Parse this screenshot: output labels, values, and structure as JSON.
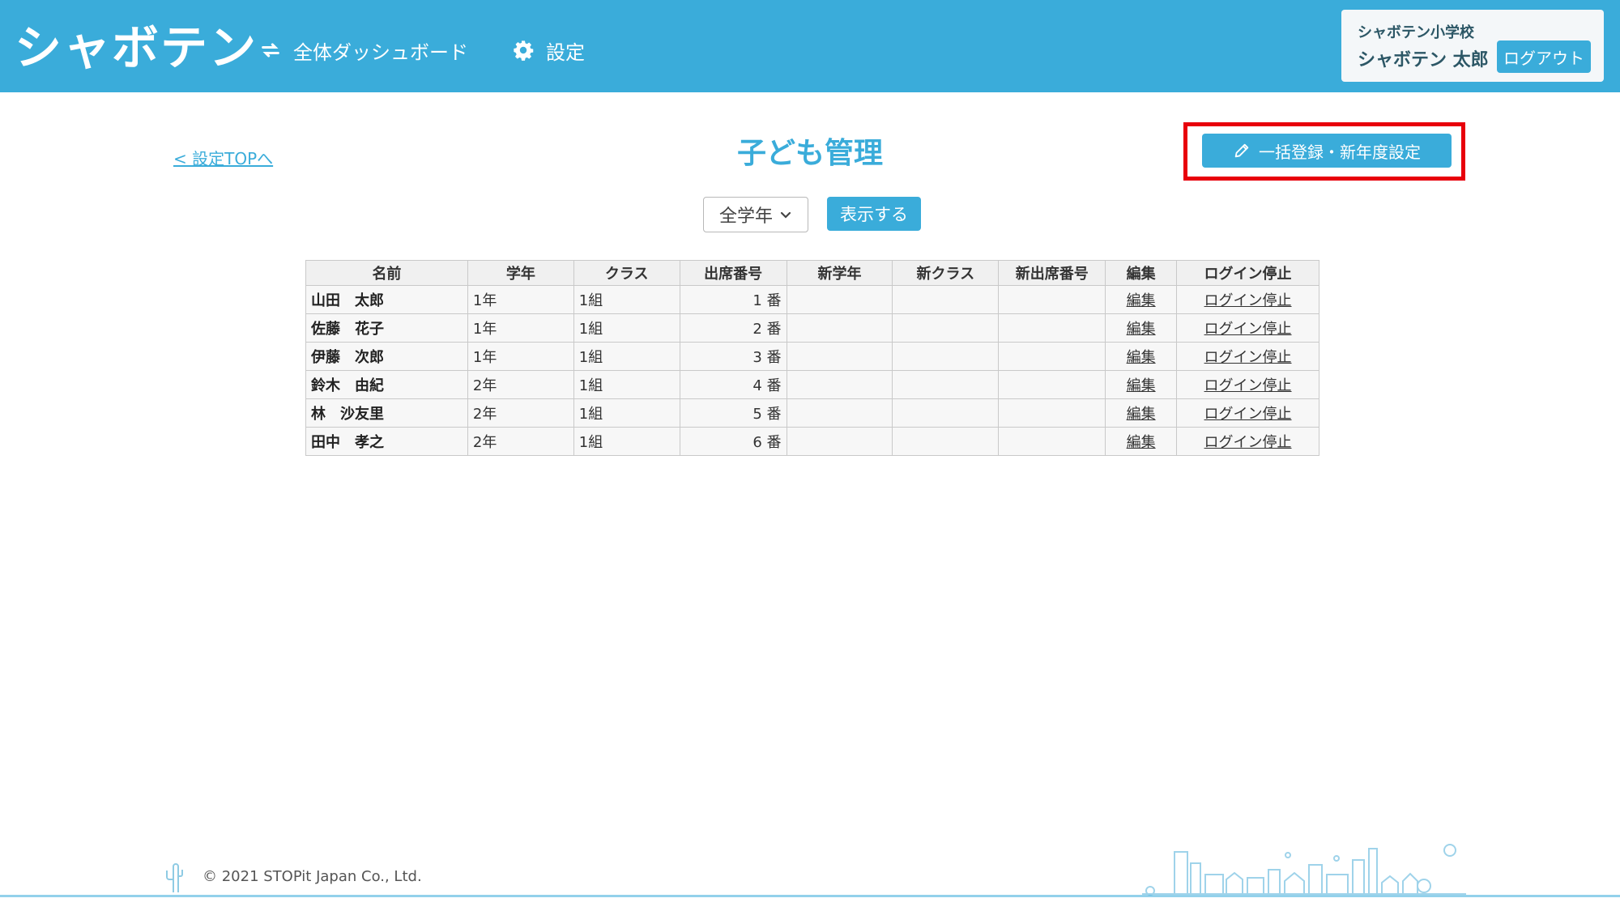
{
  "header": {
    "logo": "シャボテン",
    "nav": [
      {
        "label": "全体ダッシュボード",
        "icon": "refresh-icon"
      },
      {
        "label": "設定",
        "icon": "gear-icon"
      }
    ],
    "user": {
      "school": "シャボテン小学校",
      "name": "シャボテン 太郎",
      "logout_label": "ログアウト"
    }
  },
  "main": {
    "back_link": "< 設定TOPへ",
    "title": "子ども管理",
    "bulk_button": "一括登録・新年度設定",
    "filter": {
      "grade_selected": "全学年",
      "show_button": "表示する"
    },
    "table": {
      "headers": [
        "名前",
        "学年",
        "クラス",
        "出席番号",
        "新学年",
        "新クラス",
        "新出席番号",
        "編集",
        "ログイン停止"
      ],
      "rows": [
        {
          "name": "山田　太郎",
          "grade": "1年",
          "class": "1組",
          "number": "1 番",
          "new_grade": "",
          "new_class": "",
          "new_number": "",
          "edit": "編集",
          "login_stop": "ログイン停止"
        },
        {
          "name": "佐藤　花子",
          "grade": "1年",
          "class": "1組",
          "number": "2 番",
          "new_grade": "",
          "new_class": "",
          "new_number": "",
          "edit": "編集",
          "login_stop": "ログイン停止"
        },
        {
          "name": "伊藤　次郎",
          "grade": "1年",
          "class": "1組",
          "number": "3 番",
          "new_grade": "",
          "new_class": "",
          "new_number": "",
          "edit": "編集",
          "login_stop": "ログイン停止"
        },
        {
          "name": "鈴木　由紀",
          "grade": "2年",
          "class": "1組",
          "number": "4 番",
          "new_grade": "",
          "new_class": "",
          "new_number": "",
          "edit": "編集",
          "login_stop": "ログイン停止"
        },
        {
          "name": "林　沙友里",
          "grade": "2年",
          "class": "1組",
          "number": "5 番",
          "new_grade": "",
          "new_class": "",
          "new_number": "",
          "edit": "編集",
          "login_stop": "ログイン停止"
        },
        {
          "name": "田中　孝之",
          "grade": "2年",
          "class": "1組",
          "number": "6 番",
          "new_grade": "",
          "new_class": "",
          "new_number": "",
          "edit": "編集",
          "login_stop": "ログイン停止"
        }
      ]
    }
  },
  "footer": {
    "copyright": "© 2021 STOPit Japan Co., Ltd."
  },
  "colors": {
    "brand": "#3aacda",
    "highlight": "#e8000b"
  }
}
